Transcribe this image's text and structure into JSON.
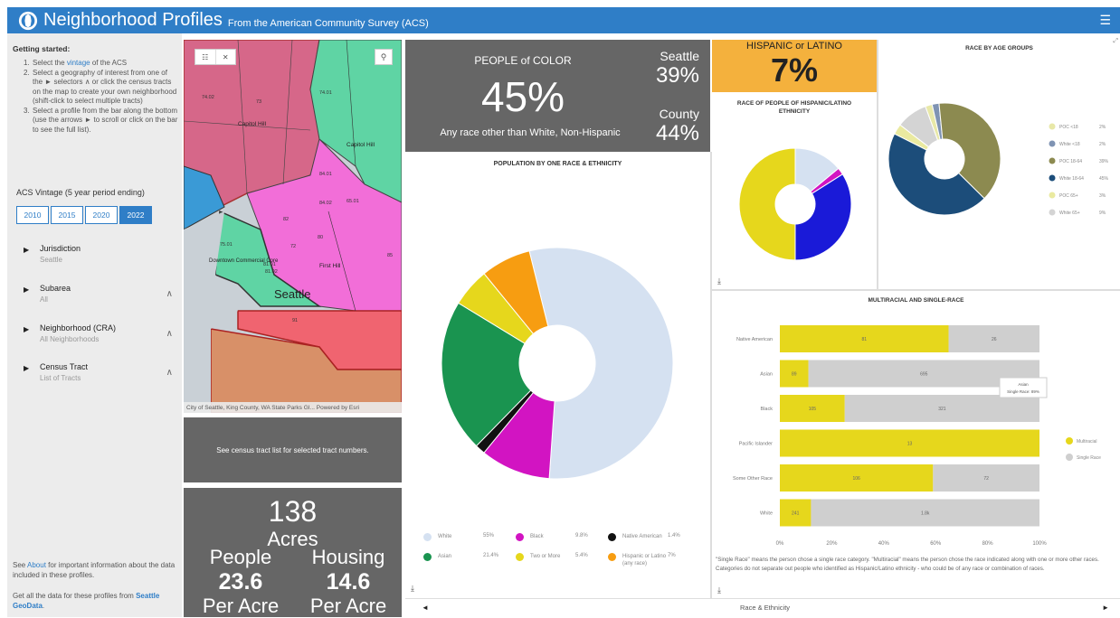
{
  "header": {
    "title": "Neighborhood Profiles",
    "subtitle": "From the American Community Survey (ACS)",
    "menu_icon": "menu-icon"
  },
  "sidebar": {
    "getting_started": "Getting started:",
    "steps": [
      {
        "n": "1.",
        "pre": "Select the ",
        "link": "vintage",
        "post": " of the ACS"
      },
      {
        "n": "2.",
        "pre": "Select a geography of interest from one of the ► selectors ∧ or click the census tracts on the map to create your own neighborhood (shift-click to select multiple tracts)",
        "link": "",
        "post": ""
      },
      {
        "n": "3.",
        "pre": "Select a profile from the bar along the bottom (use the arrows ► to scroll or click on the bar to see the full list).",
        "link": "",
        "post": ""
      }
    ],
    "vintage_title": "ACS Vintage (5 year period ending)",
    "vintages": [
      "2010",
      "2015",
      "2020",
      "2022"
    ],
    "selected_vintage": "2022",
    "selectors": [
      {
        "name": "Jurisdiction",
        "value": "Seattle",
        "caret": ""
      },
      {
        "name": "Subarea",
        "value": "All",
        "caret": "∧"
      },
      {
        "name": "Neighborhood (CRA)",
        "value": "All Neighborhoods",
        "caret": "∧"
      },
      {
        "name": "Census Tract",
        "value": "List of Tracts",
        "caret": "∧"
      }
    ],
    "about_pre": "See ",
    "about_link": "About",
    "about_post": " for important information about the data included in these profiles.",
    "geo_pre": "Get all the data for these profiles from ",
    "geo_link": "Seattle GeoData",
    "geo_post": "."
  },
  "map": {
    "attribution": "City of Seattle, King County, WA State Parks GI...   Powered by Esri",
    "labels": [
      "Capitol Hill",
      "Capitol Hill",
      "Downtown Commercial Core",
      "First Hill",
      "Seattle"
    ],
    "tract_numbers": [
      "74.01",
      "74.02",
      "73",
      "84.01",
      "84.02",
      "65.01",
      "75.01",
      "72",
      "82",
      "80",
      "81.01",
      "81.02",
      "85",
      "91"
    ],
    "list_icon": "list-icon",
    "close_icon": "close-icon",
    "search_icon": "search-icon"
  },
  "tract_message": "See census tract list for selected tract numbers.",
  "acres": {
    "value": "138",
    "label": "Acres",
    "people_label": "People",
    "housing_label": "Housing",
    "people_value": "23.6",
    "housing_value": "14.6",
    "per_acre": "Per Acre"
  },
  "poc": {
    "title": "PEOPLE of COLOR",
    "value": "45%",
    "subtitle": "Any race other than White, Non-Hispanic",
    "seattle_label": "Seattle",
    "seattle_value": "39%",
    "county_label": "County",
    "county_value": "44%"
  },
  "hispanic": {
    "title": "HISPANIC or LATINO",
    "value": "7%"
  },
  "chart_data": [
    {
      "type": "pie",
      "title": "POPULATION BY ONE RACE & ETHNICITY",
      "slices": [
        {
          "name": "White",
          "value": 55,
          "label": "55%",
          "color": "#d5e1f1"
        },
        {
          "name": "Black",
          "value": 9.8,
          "label": "9.8%",
          "color": "#d214c2"
        },
        {
          "name": "Native American",
          "value": 1.4,
          "label": "1.4%",
          "color": "#111111"
        },
        {
          "name": "Asian",
          "value": 21.4,
          "label": "21.4%",
          "color": "#1a9450"
        },
        {
          "name": "Two or More",
          "value": 5.4,
          "label": "5.4%",
          "color": "#e6d71c"
        },
        {
          "name": "Hispanic or Latino (any race)",
          "value": 7,
          "label": "7%",
          "color": "#f79d11"
        }
      ]
    },
    {
      "type": "pie",
      "title": "RACE OF PEOPLE OF HISPANIC/LATINO ETHNICITY",
      "slices": [
        {
          "name": "",
          "value": 14,
          "color": "#d5e1f1"
        },
        {
          "name": "",
          "value": 2,
          "color": "#d214c2"
        },
        {
          "name": "",
          "value": 34,
          "color": "#1a1ad8"
        },
        {
          "name": "",
          "value": 50,
          "color": "#e6d71c"
        }
      ]
    },
    {
      "type": "pie",
      "title": "RACE BY AGE GROUPS",
      "slices": [
        {
          "name": "POC <18",
          "value": 2,
          "label": "2%",
          "color": "#e8e8a8"
        },
        {
          "name": "White <18",
          "value": 2,
          "label": "2%",
          "color": "#7f93b3"
        },
        {
          "name": "POC 18-64",
          "value": 39,
          "label": "39%",
          "color": "#8c8a50"
        },
        {
          "name": "White 18-64",
          "value": 45,
          "label": "45%",
          "color": "#1c4d7a"
        },
        {
          "name": "POC 65+",
          "value": 3,
          "label": "3%",
          "color": "#eaeaa0"
        },
        {
          "name": "White 65+",
          "value": 9,
          "label": "9%",
          "color": "#d4d4d4"
        }
      ]
    },
    {
      "type": "bar",
      "title": "MULTIRACIAL AND SINGLE-RACE",
      "orientation": "horizontal",
      "stacked": true,
      "categories": [
        "Native American",
        "Asian",
        "Black",
        "Pacific Islander",
        "Some Other Race",
        "White"
      ],
      "series": [
        {
          "name": "Multiracial",
          "color": "#e6d71c",
          "values": [
            65,
            11,
            25,
            100,
            59,
            12
          ],
          "labels": [
            "81",
            "89",
            "105",
            "13",
            "106",
            "241"
          ]
        },
        {
          "name": "Single Race",
          "color": "#cfcfcf",
          "values": [
            35,
            89,
            75,
            0,
            41,
            88
          ],
          "labels": [
            "26",
            "695",
            "321",
            "",
            "72",
            "1.8k"
          ]
        }
      ],
      "xticks": [
        "0%",
        "20%",
        "40%",
        "60%",
        "80%",
        "100%"
      ],
      "tooltip": [
        "Asian",
        "Single Race: 89%"
      ],
      "note": "\"Single Race\" means the person chose a single race category. \"Multiracial\" means the person chose the race indicated along with one or more other races. Categories do not separate out people who identified as Hispanic/Latino ethnicity - who could be of any race or combination of races."
    }
  ],
  "bottom": {
    "label": "Race & Ethnicity",
    "left_arrow": "◄",
    "right_arrow": "►"
  }
}
